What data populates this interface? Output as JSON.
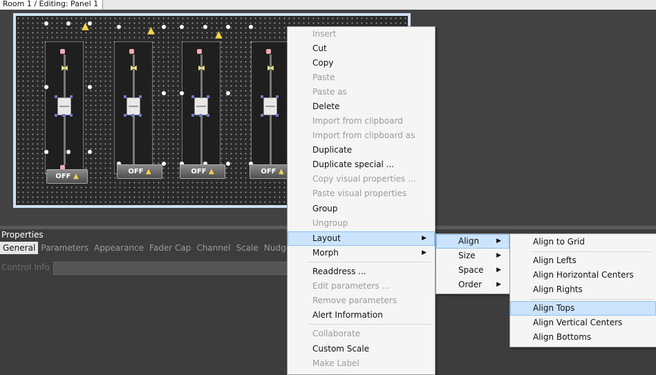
{
  "tab": {
    "label": "Room 1 / Editing: Panel 1"
  },
  "panel": {
    "off_buttons": [
      "OFF",
      "OFF",
      "OFF",
      "OFF"
    ],
    "warning_icon": "warning-triangle-icon"
  },
  "properties": {
    "title": "Properties",
    "tabs": [
      "General",
      "Parameters",
      "Appearance",
      "Fader Cap",
      "Channel",
      "Scale",
      "Nudge"
    ],
    "active_tab": "General",
    "control_info_label": "Control Info"
  },
  "context_menu": {
    "items": [
      {
        "label": "Insert",
        "enabled": false
      },
      {
        "label": "Cut",
        "enabled": true
      },
      {
        "label": "Copy",
        "enabled": true
      },
      {
        "label": "Paste",
        "enabled": false
      },
      {
        "label": "Paste as",
        "enabled": false
      },
      {
        "label": "Delete",
        "enabled": true
      },
      {
        "label": "Import from clipboard",
        "enabled": false
      },
      {
        "label": "Import from clipboard as",
        "enabled": false
      },
      {
        "label": "Duplicate",
        "enabled": true
      },
      {
        "label": "Duplicate special ...",
        "enabled": true
      },
      {
        "label": "Copy visual properties ...",
        "enabled": false
      },
      {
        "label": "Paste visual properties",
        "enabled": false
      },
      {
        "label": "Group",
        "enabled": true
      },
      {
        "label": "Ungroup",
        "enabled": false
      },
      {
        "label": "Layout",
        "enabled": true,
        "submenu": true,
        "highlighted": true
      },
      {
        "label": "Morph",
        "enabled": true,
        "submenu": true
      },
      {
        "label": "Readdress ...",
        "enabled": true
      },
      {
        "label": "Edit parameters ...",
        "enabled": false
      },
      {
        "label": "Remove parameters",
        "enabled": false
      },
      {
        "label": "Alert Information",
        "enabled": true
      },
      {
        "label": "Collaborate",
        "enabled": false
      },
      {
        "label": "Custom Scale",
        "enabled": true
      },
      {
        "label": "Make Label",
        "enabled": false
      }
    ]
  },
  "layout_submenu": {
    "items": [
      {
        "label": "Align",
        "submenu": true,
        "highlighted": true
      },
      {
        "label": "Size",
        "submenu": true
      },
      {
        "label": "Space",
        "submenu": true
      },
      {
        "label": "Order",
        "submenu": true
      }
    ]
  },
  "align_submenu": {
    "items": [
      {
        "label": "Align to Grid"
      },
      {
        "label": "Align Lefts"
      },
      {
        "label": "Align Horizontal Centers"
      },
      {
        "label": "Align Rights"
      },
      {
        "label": "Align Tops",
        "highlighted": true
      },
      {
        "label": "Align Vertical Centers"
      },
      {
        "label": "Align Bottoms"
      }
    ]
  },
  "colors": {
    "highlight": "#cce4fb",
    "warning": "#f3d54a",
    "canvas": "#2a2a2a",
    "selection_border": "#cfe1f7"
  }
}
